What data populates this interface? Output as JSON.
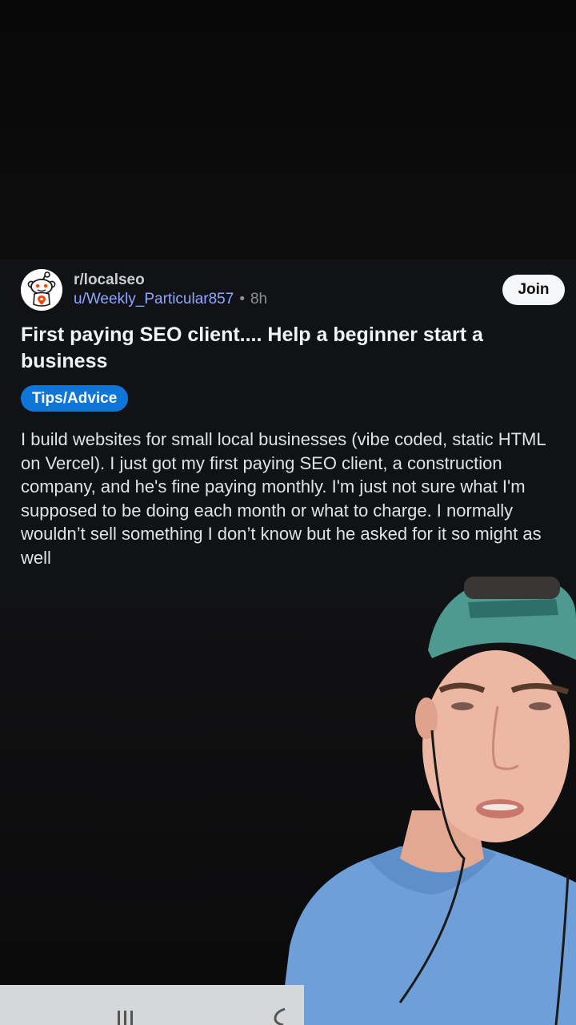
{
  "post": {
    "subreddit": "r/localseo",
    "username": "u/Weekly_Particular857",
    "separator": "•",
    "age": "8h",
    "join_label": "Join",
    "title": "First paying SEO client.... Help a beginner start a business",
    "flair": "Tips/Advice",
    "body": "I build websites for small local businesses (vibe coded, static HTML on Vercel). I just got my first paying SEO client, a construction company, and he's fine paying monthly. I'm just not sure what I'm supposed to be doing each month or what to charge. I normally wouldn’t sell something I don’t know but he asked for it so might as well"
  },
  "icons": {
    "avatar": "reddit-snoo-avatar",
    "recents": "recents-icon",
    "back": "back-icon"
  },
  "colors": {
    "card_bg": "#101216",
    "username": "#8fa7ff",
    "flair_bg": "#0d76d8",
    "join_bg": "#f5f6f7"
  }
}
